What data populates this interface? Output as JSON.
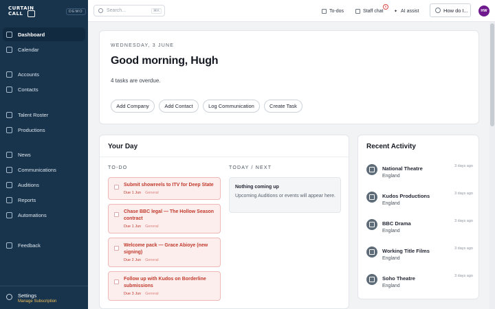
{
  "brand": {
    "line1": "CURTAIN",
    "line2": "CALL",
    "badge": "DEMO"
  },
  "sidebar": {
    "items": [
      {
        "label": "Dashboard",
        "active": true
      },
      {
        "label": "Calendar"
      },
      {
        "label": "Accounts"
      },
      {
        "label": "Contacts"
      },
      {
        "label": "Talent Roster"
      },
      {
        "label": "Productions"
      },
      {
        "label": "News"
      },
      {
        "label": "Communications"
      },
      {
        "label": "Auditions"
      },
      {
        "label": "Reports"
      },
      {
        "label": "Automations"
      },
      {
        "label": "Feedback"
      }
    ],
    "settings": {
      "label": "Settings",
      "sub": "Manage Subscription"
    }
  },
  "topbar": {
    "search_placeholder": "Search...",
    "search_shortcut": "⌘K",
    "todos": "To-dos",
    "staff_chat": "Staff chat",
    "chat_count": "6",
    "ai_assist": "AI assist",
    "how_do": "How do I...",
    "avatar_initials": "HW"
  },
  "greeting": {
    "date": "WEDNESDAY, 3 JUNE",
    "title": "Good morning, Hugh",
    "overdue": "4 tasks are overdue.",
    "actions": [
      "Add Company",
      "Add Contact",
      "Log Communication",
      "Create Task"
    ]
  },
  "your_day": {
    "title": "Your Day",
    "todo_label": "TO-DO",
    "next_label": "TODAY / NEXT",
    "tasks": [
      {
        "title": "Submit showreels to ITV for Deep State",
        "due": "Due 1 Jun",
        "tag": "General"
      },
      {
        "title": "Chase BBC legal — The Hollow Season contract",
        "due": "Due 1 Jun",
        "tag": "General"
      },
      {
        "title": "Welcome pack — Grace Abioye (new signing)",
        "due": "Due 2 Jun",
        "tag": "General"
      },
      {
        "title": "Follow up with Kudos on Borderline submissions",
        "due": "Due 3 Jun",
        "tag": "General"
      }
    ],
    "empty_title": "Nothing coming up",
    "empty_desc": "Upcoming Auditions or events will appear here."
  },
  "recent_activity": {
    "title": "Recent Activity",
    "items": [
      {
        "name": "National Theatre",
        "region": "England",
        "time": "3 days ago"
      },
      {
        "name": "Kudos Productions",
        "region": "England",
        "time": "3 days ago"
      },
      {
        "name": "BBC Drama",
        "region": "England",
        "time": "3 days ago"
      },
      {
        "name": "Working Title Films",
        "region": "England",
        "time": "3 days ago"
      },
      {
        "name": "Soho Theatre",
        "region": "England",
        "time": "3 days ago"
      }
    ]
  }
}
